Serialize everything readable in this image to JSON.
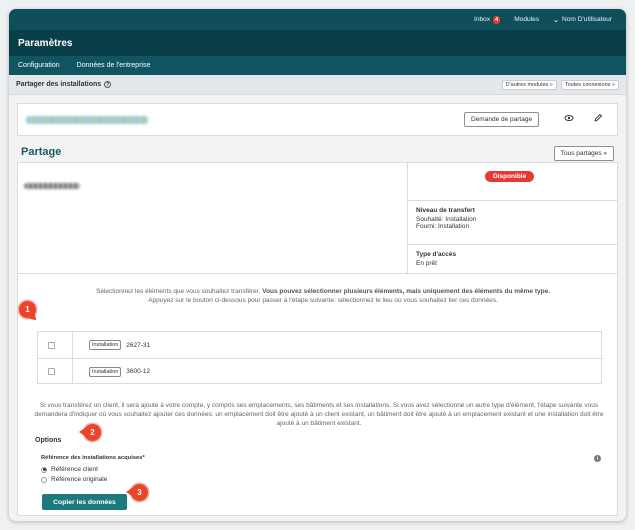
{
  "topbar": {
    "inbox_label": "Inbox",
    "inbox_count": "4",
    "modules_label": "Modules",
    "user_label": "Nom D'utilisateur"
  },
  "titlebar": {
    "title": "Paramètres"
  },
  "nav": {
    "items": [
      {
        "label": "Configuration"
      },
      {
        "label": "Données de l'entreprise"
      }
    ]
  },
  "subhead": {
    "title": "Partager des installations",
    "other_modules": "D'autres modules »",
    "all_connections": "Toutes connexions »"
  },
  "partner": {
    "request_button": "Demande de partage"
  },
  "partage": {
    "section_title": "Partage",
    "all_button": "Tous partages »",
    "status": "Disponible",
    "transfer_level_label": "Niveau de transfert",
    "souhaite": "Souhaité: Installation",
    "fourni": "Fourni: Installation",
    "access_type_label": "Type d'accès",
    "access_type_value": "En prêt"
  },
  "instructions": {
    "line1_plain": "Sélectionnez les éléments que vous souhaitez transférer. ",
    "line1_bold": "Vous pouvez sélectionner plusieurs éléments, mais uniquement des éléments du même type.",
    "line2": "Appuyez sur le bouton ci-dessous pour passer à l'étape suivante: sélectionnez le lieu où vous souhaitez lier ces données."
  },
  "items": [
    {
      "tag": "Installation",
      "label": "2627-31"
    },
    {
      "tag": "Installation",
      "label": "3600-12"
    }
  ],
  "note": "Si vous transférez un client, il sera ajouté à votre compte, y compris ses emplacements, ses bâtiments et ses installations. Si vous avez sélectionné un autre type d'élément, l'étape suivante vous demandera d'indiquer où vous souhaitez ajouter ces données: un emplacement doit être ajouté à un client existant, un bâtiment doit être ajouté à un emplacement existant et une installation doit être ajouté à un bâtiment existant.",
  "options": {
    "title": "Options",
    "ref_label": "Référence des installations acquises*",
    "choices": [
      {
        "label": "Référence client",
        "selected": true
      },
      {
        "label": "Référence originale",
        "selected": false
      }
    ]
  },
  "copy_button": "Copier les données",
  "callouts": [
    "1",
    "2",
    "3"
  ],
  "colors": {
    "header_dark": "#0a3f4a",
    "header": "#0f4f5c",
    "accent": "#1d7b80",
    "status_red": "#e53935",
    "callout": "#e8452c"
  }
}
